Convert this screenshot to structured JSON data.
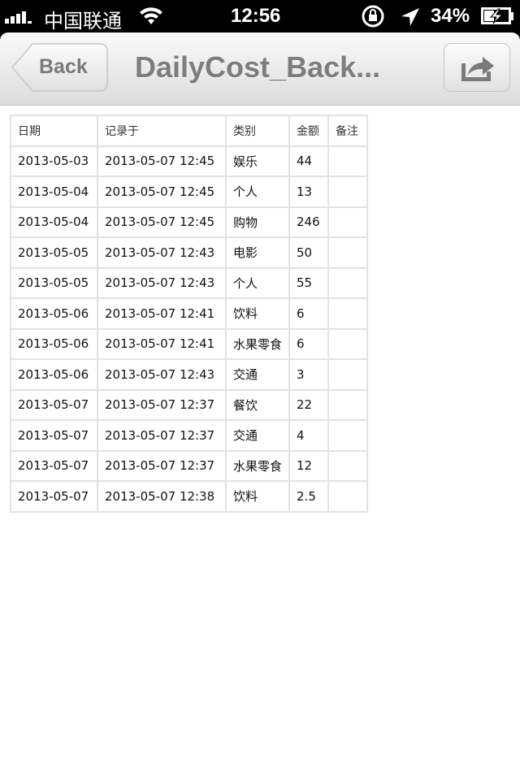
{
  "status": {
    "carrier": "中国联通",
    "time": "12:56",
    "battery": "34%"
  },
  "nav": {
    "back": "Back",
    "title": "DailyCost_Back..."
  },
  "table": {
    "headers": [
      "日期",
      "记录于",
      "类别",
      "金额",
      "备注"
    ],
    "rows": [
      [
        "2013-05-03",
        "2013-05-07 12:45",
        "娱乐",
        "44",
        ""
      ],
      [
        "2013-05-04",
        "2013-05-07 12:45",
        "个人",
        "13",
        ""
      ],
      [
        "2013-05-04",
        "2013-05-07 12:45",
        "购物",
        "246",
        ""
      ],
      [
        "2013-05-05",
        "2013-05-07 12:43",
        "电影",
        "50",
        ""
      ],
      [
        "2013-05-05",
        "2013-05-07 12:43",
        "个人",
        "55",
        ""
      ],
      [
        "2013-05-06",
        "2013-05-07 12:41",
        "饮料",
        "6",
        ""
      ],
      [
        "2013-05-06",
        "2013-05-07 12:41",
        "水果零食",
        "6",
        ""
      ],
      [
        "2013-05-06",
        "2013-05-07 12:43",
        "交通",
        "3",
        ""
      ],
      [
        "2013-05-07",
        "2013-05-07 12:37",
        "餐饮",
        "22",
        ""
      ],
      [
        "2013-05-07",
        "2013-05-07 12:37",
        "交通",
        "4",
        ""
      ],
      [
        "2013-05-07",
        "2013-05-07 12:37",
        "水果零食",
        "12",
        ""
      ],
      [
        "2013-05-07",
        "2013-05-07 12:38",
        "饮料",
        "2.5",
        ""
      ]
    ]
  }
}
